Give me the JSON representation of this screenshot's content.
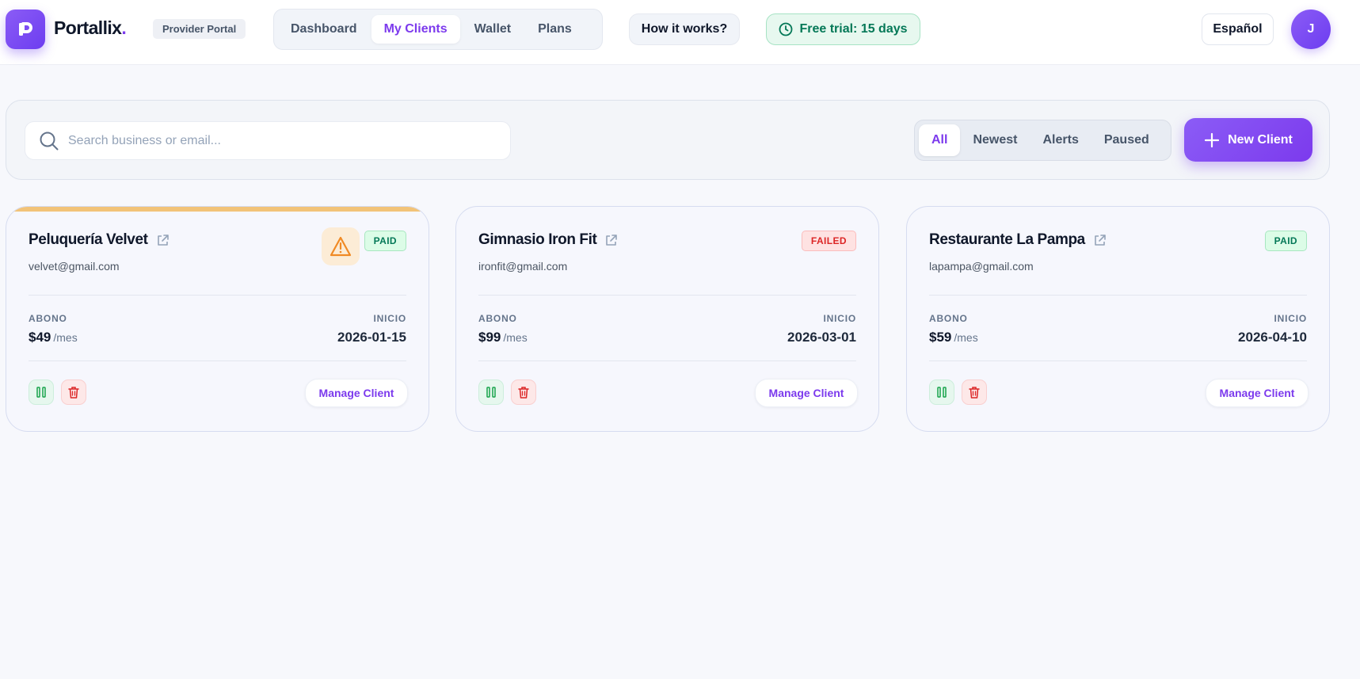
{
  "brand": {
    "name": "Portallix",
    "dot": ".",
    "portal_label": "Provider Portal"
  },
  "nav": {
    "items": [
      {
        "label": "Dashboard",
        "active": false
      },
      {
        "label": "My Clients",
        "active": true
      },
      {
        "label": "Wallet",
        "active": false
      },
      {
        "label": "Plans",
        "active": false
      }
    ]
  },
  "header": {
    "how_it_works": "How it works?",
    "trial_label": "Free trial: 15 days",
    "language": "Español",
    "avatar_initial": "J"
  },
  "toolbar": {
    "search_placeholder": "Search business or email...",
    "search_value": "",
    "filters": [
      {
        "label": "All",
        "active": true
      },
      {
        "label": "Newest",
        "active": false
      },
      {
        "label": "Alerts",
        "active": false
      },
      {
        "label": "Paused",
        "active": false
      }
    ],
    "new_client_label": "New Client"
  },
  "cards": [
    {
      "name": "Peluquería Velvet",
      "email": "velvet@gmail.com",
      "status": "PAID",
      "alert": true,
      "abono_label": "ABONO",
      "price": "$49",
      "price_unit": "/mes",
      "inicio_label": "INICIO",
      "start_date": "2026-01-15",
      "manage_label": "Manage Client"
    },
    {
      "name": "Gimnasio Iron Fit",
      "email": "ironfit@gmail.com",
      "status": "FAILED",
      "alert": false,
      "abono_label": "ABONO",
      "price": "$99",
      "price_unit": "/mes",
      "inicio_label": "INICIO",
      "start_date": "2026-03-01",
      "manage_label": "Manage Client"
    },
    {
      "name": "Restaurante La Pampa",
      "email": "lapampa@gmail.com",
      "status": "PAID",
      "alert": false,
      "abono_label": "ABONO",
      "price": "$59",
      "price_unit": "/mes",
      "inicio_label": "INICIO",
      "start_date": "2026-04-10",
      "manage_label": "Manage Client"
    }
  ],
  "colors": {
    "accent": "#7c3aed",
    "paid": "#047857",
    "failed": "#dc2626",
    "alert": "#f2c378"
  }
}
